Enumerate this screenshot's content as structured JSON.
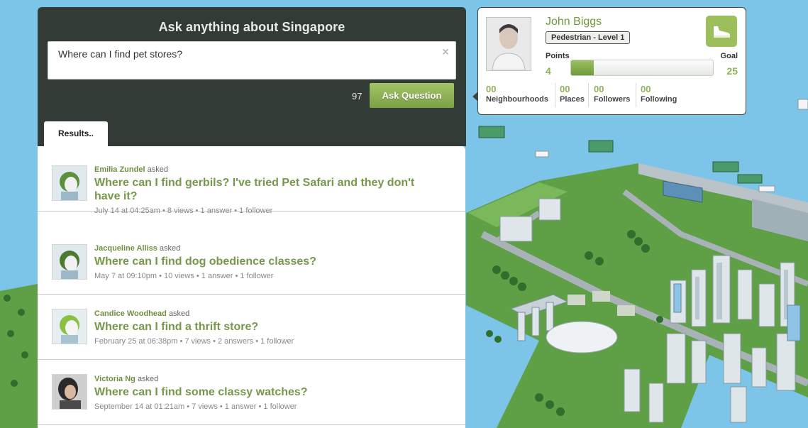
{
  "ask": {
    "title": "Ask anything about Singapore",
    "question_value": "Where can I find pet stores?",
    "char_count": "97",
    "ask_button_label": "Ask Question",
    "results_tab_label": "Results.."
  },
  "results": [
    {
      "author": "Emilia Zundel",
      "asked": "asked",
      "title": "Where can I find gerbils? I've tried Pet Safari and they don't have it?",
      "meta": "July 14 at 04:25am • 8 views • 1 answer • 1 follower",
      "avatar_icon": "cartoon-avatar-icon"
    },
    {
      "author": "Jacqueline Alliss",
      "asked": "asked",
      "title": "Where can I find dog obedience classes?",
      "meta": "May 7 at 09:10pm • 10 views • 1 answer • 1 follower",
      "avatar_icon": "cartoon-avatar-icon"
    },
    {
      "author": "Candice Woodhead",
      "asked": "asked",
      "title": "Where can I find a thrift store?",
      "meta": "February 25 at 06:38pm • 7 views • 2 answers • 1 follower",
      "avatar_icon": "cartoon-avatar-icon"
    },
    {
      "author": "Victoria Ng",
      "asked": "asked",
      "title": "Where can I find some classy watches?",
      "meta": "September 14 at 01:21am • 7 views • 1 answer • 1 follower",
      "avatar_icon": "photo-avatar-icon"
    }
  ],
  "profile": {
    "name": "John Biggs",
    "level": "Pedestrian - Level 1",
    "points_label": "Points",
    "goal_label": "Goal",
    "points": "4",
    "goal": "25",
    "progress_fraction": 0.16,
    "badge_icon": "shoe-icon",
    "stats": [
      {
        "value": "00",
        "label": "Neighbourhoods"
      },
      {
        "value": "00",
        "label": "Places"
      },
      {
        "value": "00",
        "label": "Followers"
      },
      {
        "value": "00",
        "label": "Following"
      }
    ]
  },
  "colors": {
    "panel_dark": "#333b37",
    "accent_green": "#76984a",
    "sea_blue": "#7cc4e8",
    "grass_green": "#6aa84f"
  }
}
